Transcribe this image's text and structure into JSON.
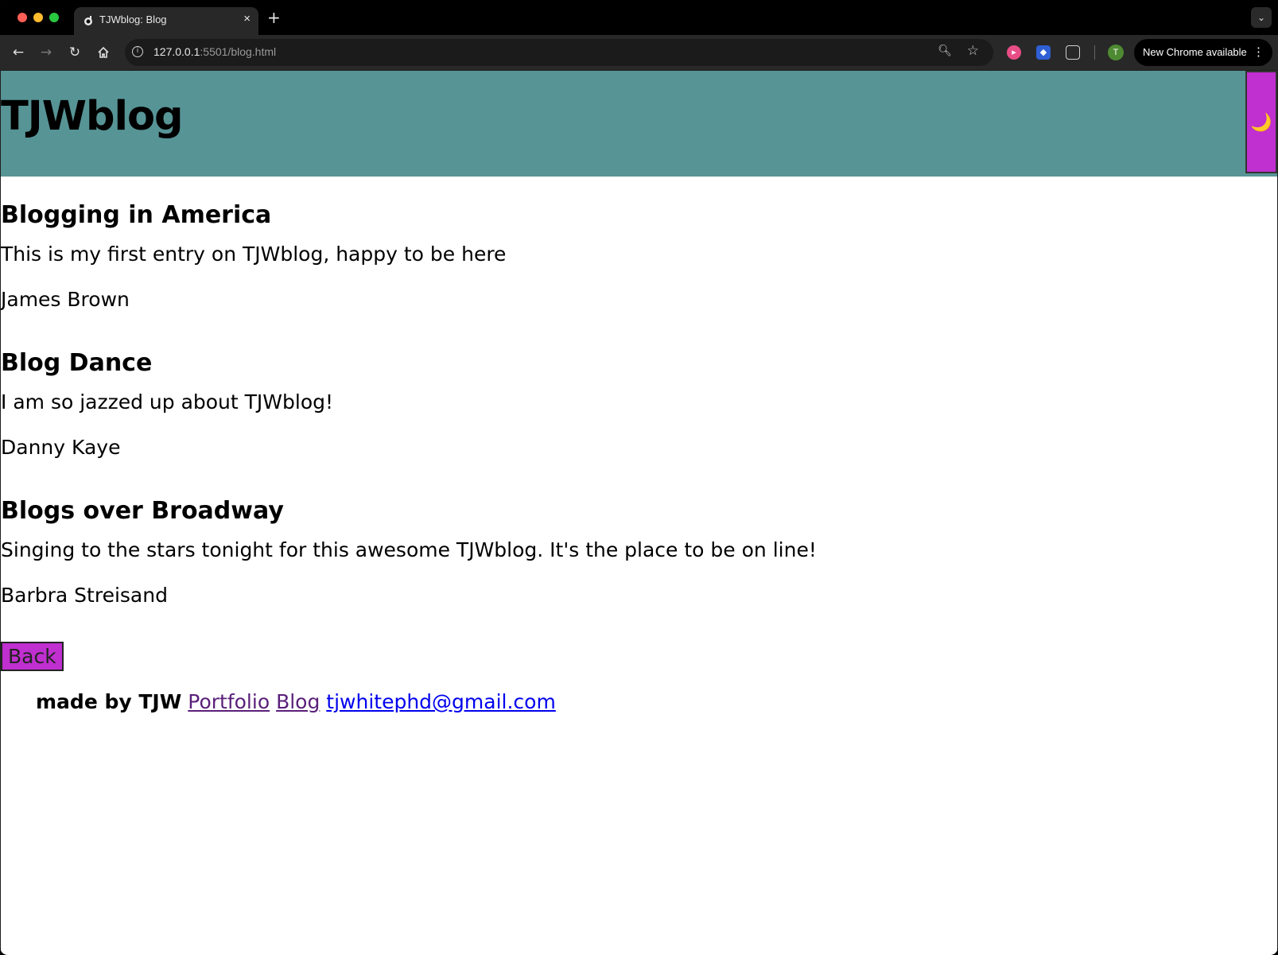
{
  "browser": {
    "tab_title": "TJWblog: Blog",
    "tab_close": "×",
    "new_tab": "+",
    "url_host": "127.0.0.1",
    "url_rest": ":5501/blog.html",
    "update_label": "New Chrome available",
    "profile_initial": "T"
  },
  "site": {
    "title": "TJWblog",
    "theme_toggle_icon": "🌙"
  },
  "posts": [
    {
      "title": "Blogging in America",
      "body": "This is my first entry on TJWblog, happy to be here",
      "author": "James Brown"
    },
    {
      "title": "Blog Dance",
      "body": "I am so jazzed up about TJWblog!",
      "author": "Danny Kaye"
    },
    {
      "title": "Blogs over Broadway",
      "body": "Singing to the stars tonight for this awesome TJWblog. It's the place to be on line!",
      "author": "Barbra Streisand"
    }
  ],
  "back_label": "Back",
  "footer": {
    "made_by": "made by TJW",
    "links": [
      "Portfolio",
      "Blog",
      "tjwhitephd@gmail.com"
    ]
  },
  "colors": {
    "header_bg": "#579496",
    "accent_purple": "#c02fcf"
  }
}
